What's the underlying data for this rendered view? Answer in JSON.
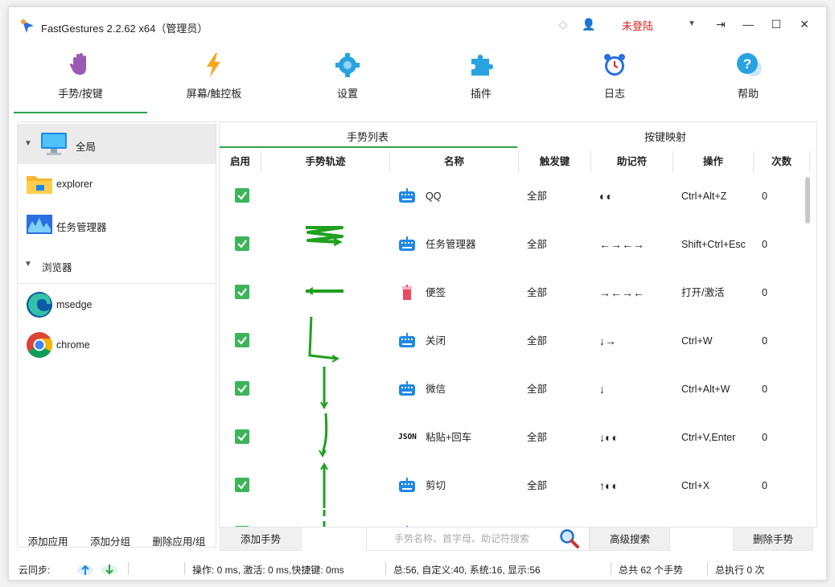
{
  "window": {
    "title": "FastGestures 2.2.62 x64（管理员）",
    "login_label": "未登陆",
    "dropdown_glyph": "▼",
    "pin_glyph": "⇥",
    "min_glyph": "—",
    "max_glyph": "☐",
    "close_glyph": "✕"
  },
  "nav": {
    "items": [
      {
        "label": "手势/按键",
        "icon": "hand-icon",
        "active": true
      },
      {
        "label": "屏幕/触控板",
        "icon": "lightning-icon"
      },
      {
        "label": "设置",
        "icon": "gear-icon"
      },
      {
        "label": "插件",
        "icon": "puzzle-icon"
      },
      {
        "label": "日志",
        "icon": "alarm-clock-icon"
      },
      {
        "label": "帮助",
        "icon": "help-icon"
      }
    ]
  },
  "tree": {
    "items": [
      {
        "label": "全局",
        "icon": "monitor-icon",
        "type": "group"
      },
      {
        "label": "explorer",
        "icon": "folder-icon"
      },
      {
        "label": "任务管理器",
        "icon": "task-manager-icon"
      },
      {
        "label": "浏览器",
        "type": "group"
      },
      {
        "label": "msedge",
        "icon": "edge-icon"
      },
      {
        "label": "chrome",
        "icon": "chrome-icon"
      }
    ],
    "footer": {
      "add_app": "添加应用",
      "add_group": "添加分组",
      "delete": "删除应用/组"
    }
  },
  "tabs": {
    "gestures": "手势列表",
    "keymap": "按键映射"
  },
  "table": {
    "headers": {
      "enabled": "启用",
      "trail": "手势轨迹",
      "name": "名称",
      "trigger": "触发键",
      "mnemonic": "助记符",
      "action": "操作",
      "count": "次数"
    },
    "rows": [
      {
        "name": "QQ",
        "icon": "keyboard-icon",
        "trigger": "全部",
        "mnemonic": "◐◐",
        "action": "Ctrl+Alt+Z",
        "count": "0",
        "trail": "none"
      },
      {
        "name": "任务管理器",
        "icon": "keyboard-icon",
        "trigger": "全部",
        "mnemonic": "←→←→",
        "action": "Shift+Ctrl+Esc",
        "count": "0",
        "trail": "zigzag"
      },
      {
        "name": "便签",
        "icon": "sticky-note-icon",
        "trigger": "全部",
        "mnemonic": "→←→←",
        "action": "打开/激活",
        "count": "0",
        "trail": "horizontal"
      },
      {
        "name": "关闭",
        "icon": "keyboard-icon",
        "trigger": "全部",
        "mnemonic": "↓→",
        "action": "Ctrl+W",
        "count": "0",
        "trail": "down-right"
      },
      {
        "name": "微信",
        "icon": "keyboard-icon",
        "trigger": "全部",
        "mnemonic": "↓",
        "action": "Ctrl+Alt+W",
        "count": "0",
        "trail": "down"
      },
      {
        "name": "粘贴+回车",
        "icon": "json-icon",
        "icon_text": "JSON",
        "trigger": "全部",
        "mnemonic": "↓◐◐",
        "action": "Ctrl+V,Enter",
        "count": "0",
        "trail": "down-curve"
      },
      {
        "name": "剪切",
        "icon": "keyboard-icon",
        "trigger": "全部",
        "mnemonic": "↑◐◐",
        "action": "Ctrl+X",
        "count": "0",
        "trail": "up"
      },
      {
        "name": "",
        "icon": "keyboard-icon",
        "trigger": "",
        "mnemonic": "",
        "action": "",
        "count": "",
        "trail": "dashed"
      }
    ]
  },
  "toolbar": {
    "add_gesture": "添加手势",
    "search_placeholder": "手势名称、首字母、助记符搜索",
    "advanced_search": "高级搜索",
    "delete_gesture": "删除手势"
  },
  "status": {
    "sync_label": "云同步:",
    "timing": "操作: 0 ms, 激活: 0 ms,快捷键: 0ms",
    "stats": "总:56, 自定义:40, 系统:16, 显示:56",
    "total": "总共 62 个手势",
    "executed": "总执行 0 次"
  },
  "colors": {
    "accent": "#2ea44f",
    "check": "#3db45a",
    "login": "#e02020",
    "trail": "#1fa01f"
  }
}
